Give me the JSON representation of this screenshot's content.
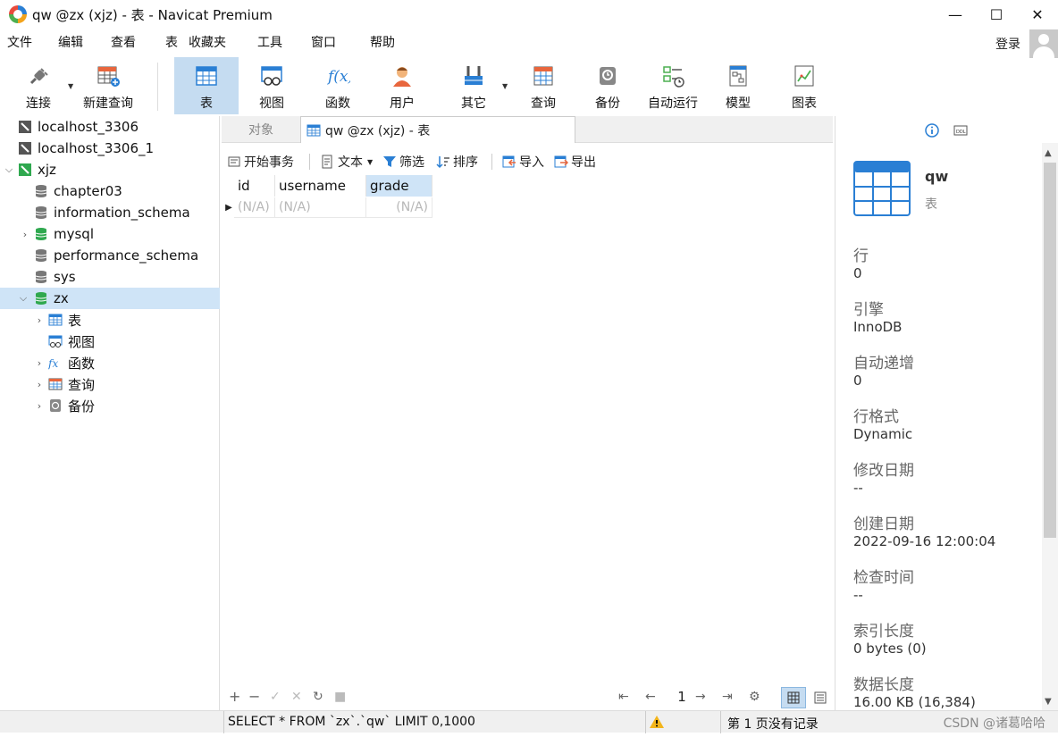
{
  "window": {
    "title": "qw @zx (xjz) - 表 - Navicat Premium",
    "minimize": "—",
    "maximize": "☐",
    "close": "✕"
  },
  "menu": {
    "items": [
      "文件",
      "编辑",
      "查看",
      "表",
      "收藏夹",
      "工具",
      "窗口",
      "帮助"
    ],
    "login": "登录"
  },
  "toolbar": {
    "connect": "连接",
    "new_query": "新建查询",
    "table": "表",
    "view": "视图",
    "function": "函数",
    "user": "用户",
    "other": "其它",
    "query": "查询",
    "backup": "备份",
    "automation": "自动运行",
    "model": "模型",
    "chart": "图表"
  },
  "tree": {
    "items": [
      "localhost_3306",
      "localhost_3306_1",
      "xjz",
      "chapter03",
      "information_schema",
      "mysql",
      "performance_schema",
      "sys",
      "zx",
      "表",
      "视图",
      "函数",
      "查询",
      "备份"
    ]
  },
  "tabs": {
    "objects": "对象",
    "active": "qw @zx (xjz) - 表"
  },
  "data_toolbar": {
    "begin_tx": "开始事务",
    "text": "文本",
    "filter": "筛选",
    "sort": "排序",
    "import": "导入",
    "export": "导出"
  },
  "grid": {
    "columns": [
      "id",
      "username",
      "grade"
    ],
    "row": [
      "(N/A)",
      "(N/A)",
      "(N/A)"
    ]
  },
  "pager": {
    "page": "1"
  },
  "status": {
    "sql": "SELECT * FROM `zx`.`qw` LIMIT 0,1000",
    "page_info": "第 1 页没有记录",
    "watermark": "CSDN @诸葛哈哈"
  },
  "info": {
    "name": "qw",
    "type": "表",
    "fields": [
      {
        "label": "行",
        "value": "0"
      },
      {
        "label": "引擎",
        "value": "InnoDB"
      },
      {
        "label": "自动递增",
        "value": "0"
      },
      {
        "label": "行格式",
        "value": "Dynamic"
      },
      {
        "label": "修改日期",
        "value": "--"
      },
      {
        "label": "创建日期",
        "value": "2022-09-16 12:00:04"
      },
      {
        "label": "检查时间",
        "value": "--"
      },
      {
        "label": "索引长度",
        "value": "0 bytes (0)"
      },
      {
        "label": "数据长度",
        "value": "16.00 KB (16,384)"
      }
    ]
  },
  "colors": {
    "accent": "#2a7fd4",
    "selected": "#cfe4f7",
    "active_tool": "#c5dcf1",
    "db_green": "#2fa84f"
  }
}
